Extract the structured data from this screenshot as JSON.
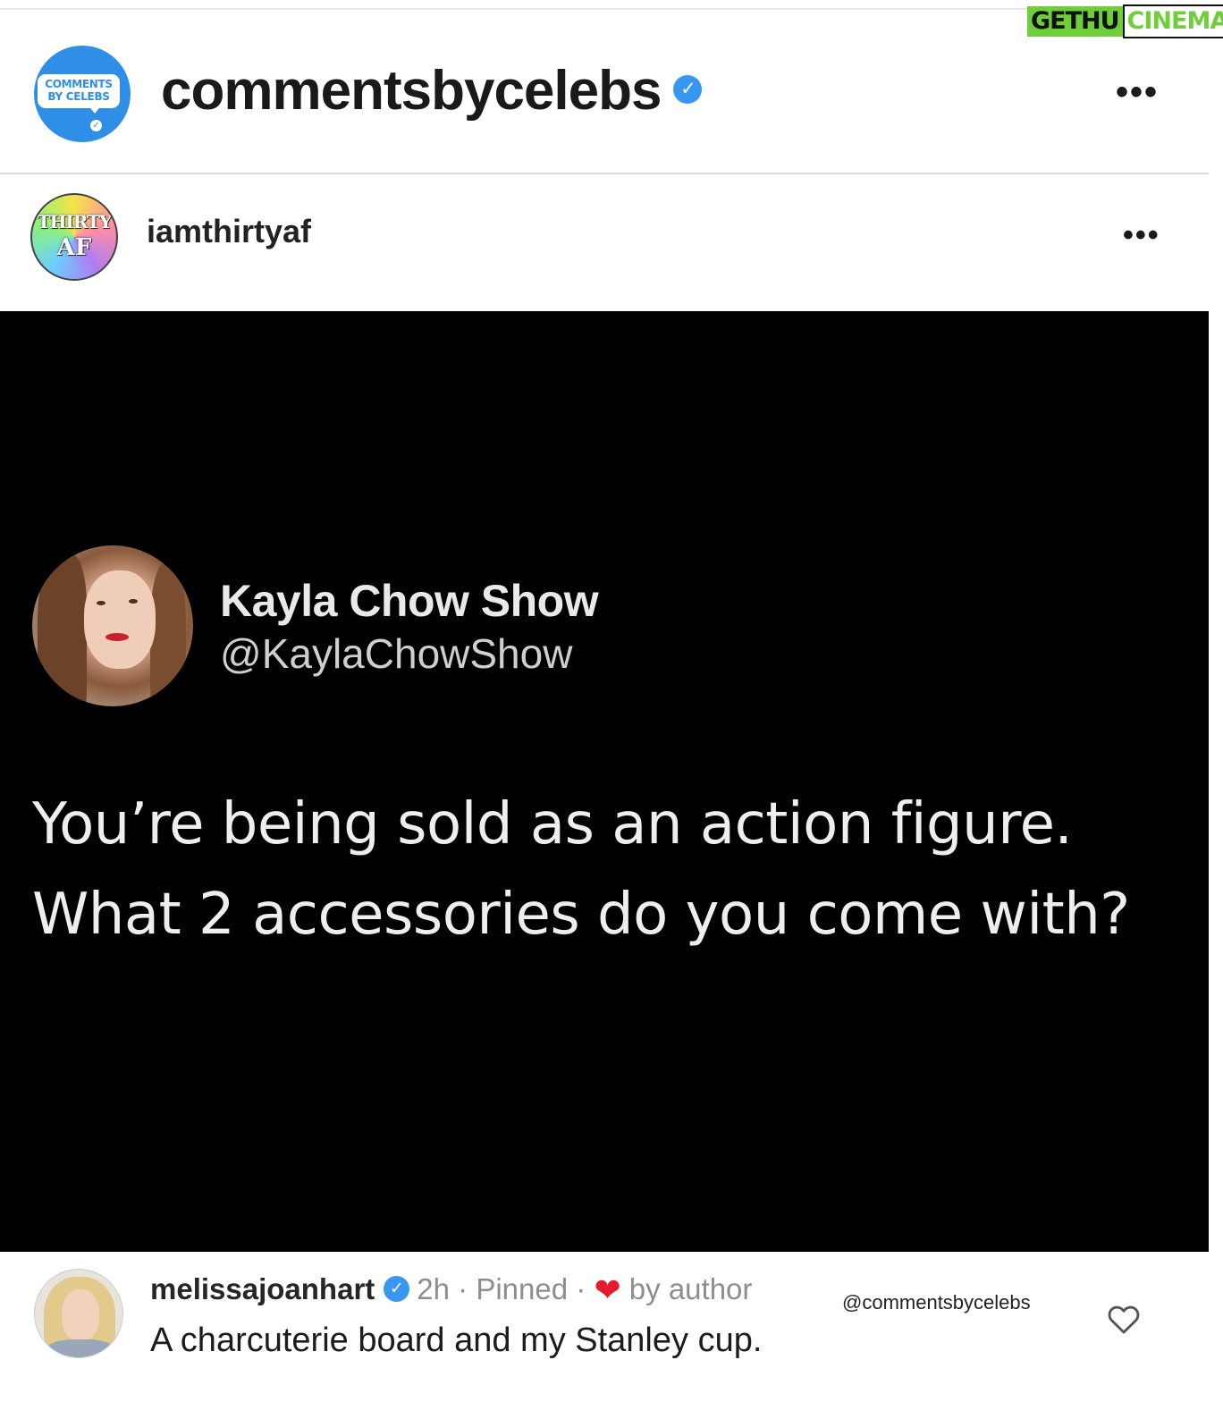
{
  "account": {
    "avatar_line1": "COMMENTS",
    "avatar_line2": "BY CELEBS",
    "username": "commentsbycelebs",
    "more_glyph": "•••"
  },
  "watermark": {
    "part1": "GETHU",
    "part2": "CINEMA"
  },
  "post": {
    "avatar_line1": "THIRTY",
    "avatar_line2": "AF",
    "username": "iamthirtyaf",
    "more_glyph": "•••"
  },
  "tweet": {
    "name": "Kayla Chow Show",
    "handle": "@KaylaChowShow",
    "text_line1": "You’re being sold as an action figure.",
    "text_line2": "What 2 accessories do you come with?"
  },
  "comment": {
    "username": "melissajoanhart",
    "time": "2h",
    "separator": "·",
    "pinned": "Pinned",
    "liked_by": "by author",
    "text": "A charcuterie board and my Stanley cup.",
    "credit": "@commentsbycelebs"
  },
  "icons": {
    "verified": "verified-badge-icon",
    "more": "more-options-icon",
    "heart_filled": "heart-filled-icon",
    "heart_outline": "heart-outline-icon"
  },
  "colors": {
    "verified_blue": "#3897f0",
    "brand_blue": "#2f8fe6",
    "heart_red": "#e41b2b",
    "watermark_green": "#6fcf3a"
  }
}
